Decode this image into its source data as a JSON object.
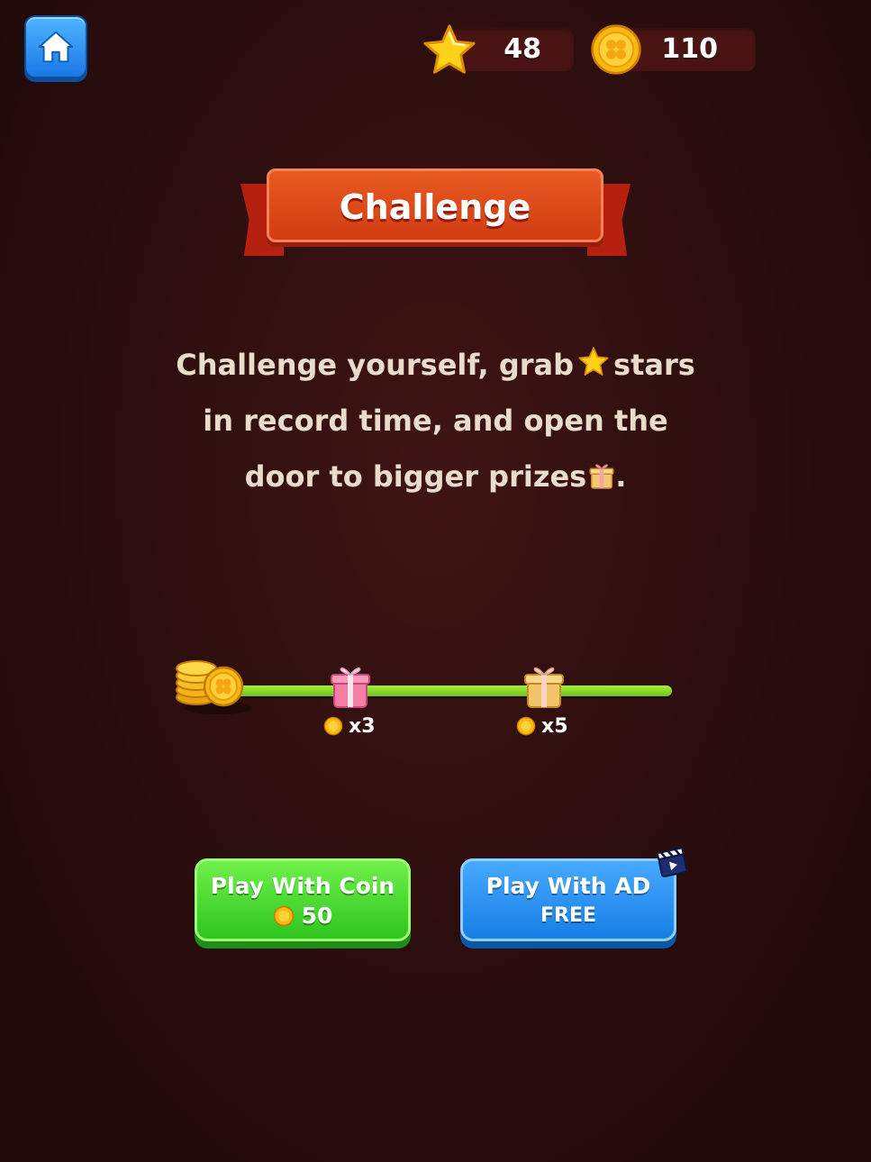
{
  "header": {
    "stars_count": "48",
    "coins_count": "110",
    "icons": [
      "home-icon",
      "star-icon",
      "coin-icon"
    ]
  },
  "title": "Challenge",
  "description": {
    "line1_a": "Challenge yourself, grab",
    "line1_b": "stars",
    "line2": "in record time, and open the",
    "line3_a": "door to bigger prizes",
    "line3_b": "."
  },
  "progress": {
    "milestones": [
      {
        "reward": "x3",
        "icon": "pink-gift-icon"
      },
      {
        "reward": "x5",
        "icon": "gold-gift-icon"
      }
    ]
  },
  "buttons": {
    "coin": {
      "label": "Play With Coin",
      "cost": "50"
    },
    "ad": {
      "label": "Play With AD",
      "sub": "FREE"
    }
  },
  "colors": {
    "background": "#2a0d0d",
    "ribbon": "#d94314",
    "track": "#8fdc2a",
    "coin_button": "#3fd42a",
    "ad_button": "#2b8ef2",
    "home_button": "#2f90f0"
  }
}
